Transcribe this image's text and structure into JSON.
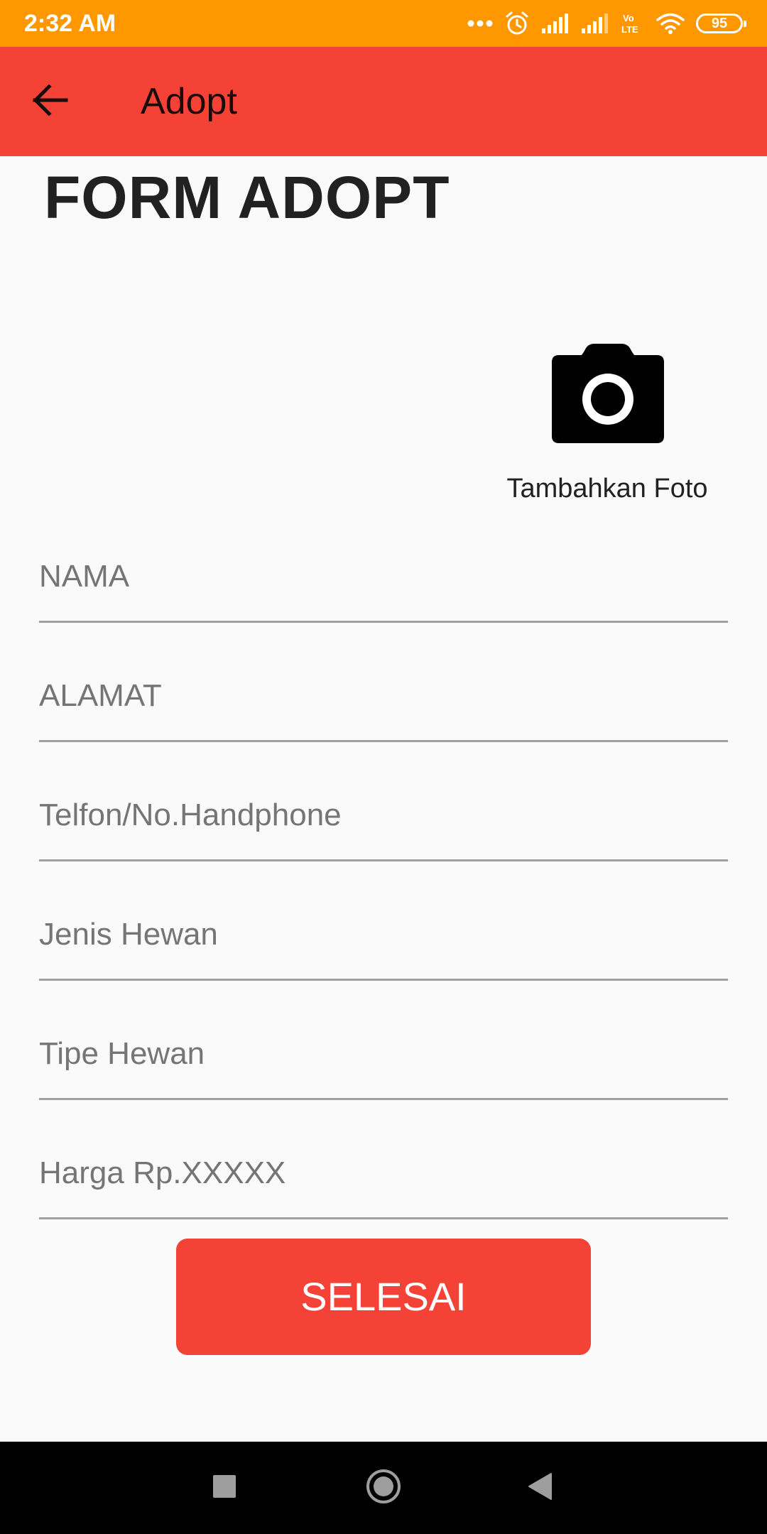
{
  "status_bar": {
    "time": "2:32 AM",
    "battery": "95",
    "icons": [
      "more-dots-icon",
      "alarm-icon",
      "signal-icon",
      "signal-icon",
      "volte-icon",
      "wifi-icon",
      "battery-icon"
    ],
    "background": "#ff9800"
  },
  "app_bar": {
    "title": "Adopt",
    "back_icon": "arrow-left-icon",
    "background": "#f44336"
  },
  "main": {
    "form_title": "FORM ADOPT",
    "photo": {
      "icon": "camera-icon",
      "label": "Tambahkan Foto"
    },
    "fields": [
      {
        "placeholder": "NAMA",
        "value": ""
      },
      {
        "placeholder": "ALAMAT",
        "value": ""
      },
      {
        "placeholder": "Telfon/No.Handphone",
        "value": ""
      },
      {
        "placeholder": "Jenis Hewan",
        "value": ""
      },
      {
        "placeholder": "Tipe Hewan",
        "value": ""
      },
      {
        "placeholder": "Harga Rp.XXXXX",
        "value": ""
      }
    ],
    "submit_label": "SELESAI",
    "accent": "#f44336"
  },
  "nav_bar": {
    "icons": [
      "square-recents-icon",
      "circle-home-icon",
      "triangle-back-icon"
    ]
  }
}
